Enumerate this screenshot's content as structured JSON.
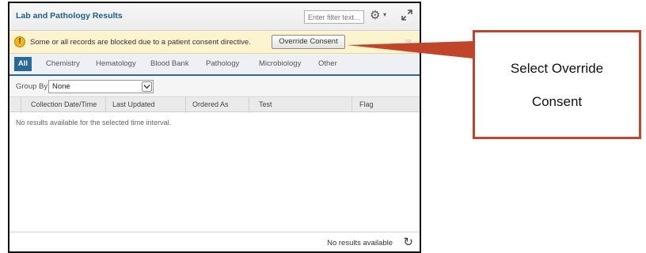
{
  "panel": {
    "title": "Lab and Pathology Results",
    "filter_placeholder": "Enter filter text...",
    "gear_caret": "▾"
  },
  "banner": {
    "message": "Some or all records are blocked due to a patient consent directive.",
    "button_label": "Override Consent",
    "icon": "warning-icon"
  },
  "tabs": [
    {
      "label": "All",
      "active": true
    },
    {
      "label": "Chemistry"
    },
    {
      "label": "Hematology"
    },
    {
      "label": "Blood Bank"
    },
    {
      "label": "Pathology"
    },
    {
      "label": "Microbiology"
    },
    {
      "label": "Other"
    }
  ],
  "group_by": {
    "label": "Group By",
    "value": "None"
  },
  "columns": [
    "Collection Date/Time",
    "Last Updated",
    "Ordered As",
    "Test",
    "Flag"
  ],
  "empty_message": "No results available for the selected time interval.",
  "footer": {
    "status": "No results available"
  },
  "callout": {
    "line1": "Select Override",
    "line2": "Consent"
  },
  "colors": {
    "accent": "#2b6a94",
    "title": "#1e5f8a",
    "banner_bg": "#fcf3cf",
    "callout": "#c0452b"
  }
}
